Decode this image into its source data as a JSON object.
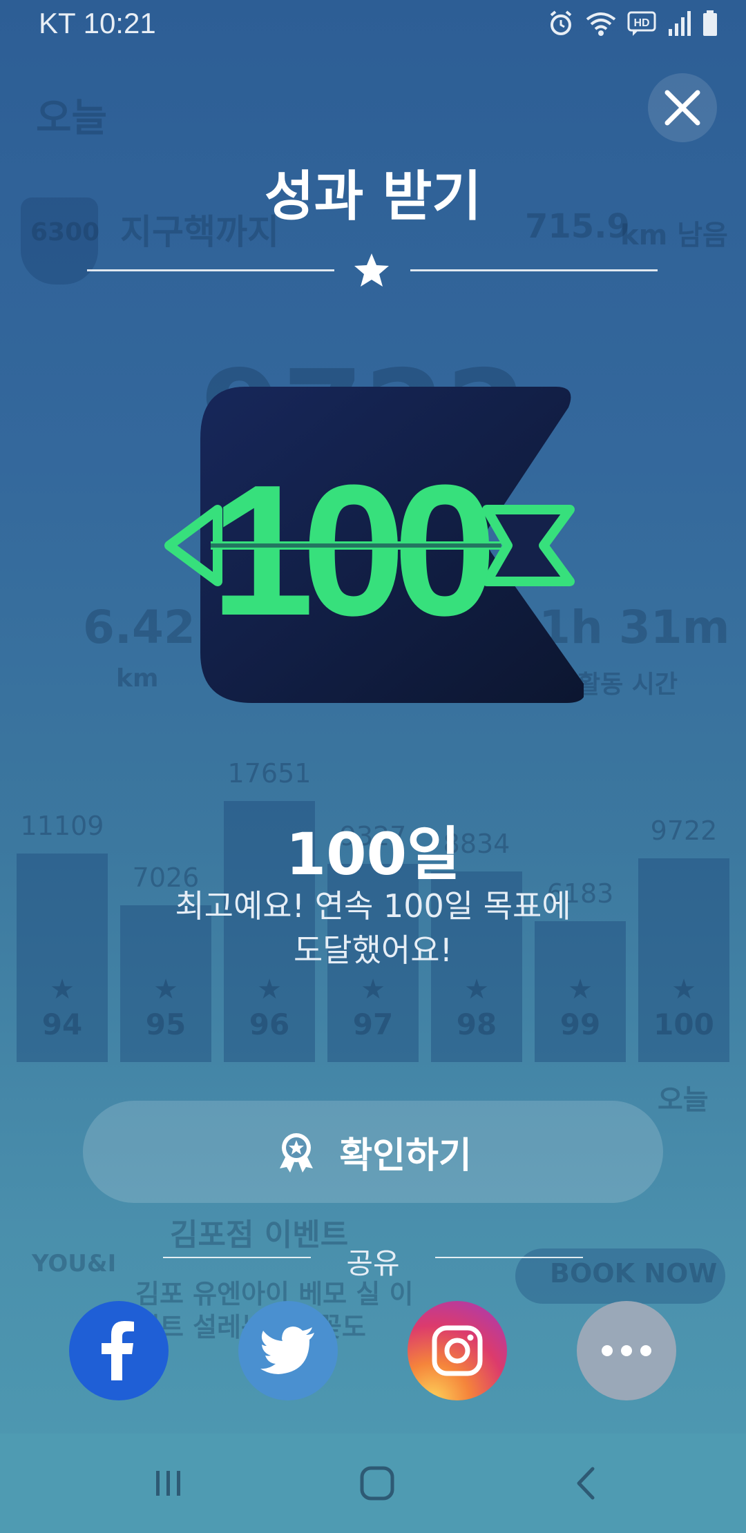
{
  "status_bar": {
    "carrier_time": "KT 10:21"
  },
  "background": {
    "header_title": "오늘",
    "goal_badge": "6300",
    "goal_name": "지구핵까지",
    "goal_distance": "715.9",
    "goal_unit": "km 남음",
    "big_steps": "9722",
    "distance_value": "6.42",
    "distance_unit": "km",
    "time_value": "1h 31m",
    "time_label": "활동 시간",
    "bars": [
      {
        "steps": "11109",
        "day": "94",
        "level": 0.8
      },
      {
        "steps": "7026",
        "day": "95",
        "level": 0.6
      },
      {
        "steps": "17651",
        "day": "96",
        "level": 1.0
      },
      {
        "steps": "9327",
        "day": "97",
        "level": 0.76
      },
      {
        "steps": "8834",
        "day": "98",
        "level": 0.73
      },
      {
        "steps": "6183",
        "day": "99",
        "level": 0.54
      },
      {
        "steps": "9722",
        "day": "100",
        "level": 0.78
      }
    ],
    "today_label": "오늘",
    "event_title": "김포점 이벤트",
    "event_text": "김포 유엔아이 베모 실 이벤트 설레는 봄, 꽃도",
    "event_brand": "YOU&I",
    "event_button": "BOOK NOW"
  },
  "modal": {
    "title": "성과 받기",
    "badge_number": "100",
    "achievement_title": "100일",
    "achievement_desc_line1": "최고예요! 연속 100일 목표에",
    "achievement_desc_line2": "도달했어요!",
    "confirm_label": "확인하기",
    "share_label": "공유"
  },
  "share_buttons": [
    {
      "name": "facebook",
      "icon": "facebook-icon",
      "color": "#1f5fd6"
    },
    {
      "name": "twitter",
      "icon": "twitter-icon",
      "color": "#4a90d0"
    },
    {
      "name": "instagram",
      "icon": "instagram-icon",
      "color": "#d93f76"
    },
    {
      "name": "more",
      "icon": "more-icon",
      "color": "#9aa8b8"
    }
  ],
  "colors": {
    "badge_green": "#37e07c",
    "badge_navy": "#14214a",
    "facebook": "#1f5fd6",
    "twitter": "#4a90d0",
    "more": "#9aa8b8"
  }
}
